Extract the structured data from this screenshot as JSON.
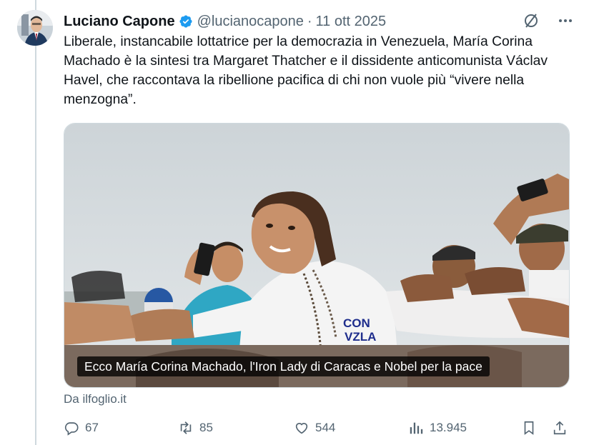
{
  "tweet": {
    "author_name": "Luciano Capone",
    "handle": "@lucianocapone",
    "separator": "·",
    "date": "11 ott 2025",
    "text": "Liberale, instancabile lottatrice per la democrazia in Venezuela, María Corina Machado è la sintesi tra Margaret Thatcher e il dissidente anticomunista Václav Havel, che raccontava la ribellione pacifica di chi non vuole più “vivere nella menzogna”.",
    "verified_color": "#1d9bf0"
  },
  "media": {
    "caption": "Ecco María Corina Machado, l'Iron Lady di Caracas e Nobel per la pace",
    "shirt_text_line1": "CON",
    "shirt_text_line2": "VZLA"
  },
  "source": "Da ilfoglio.it",
  "actions": {
    "replies": "67",
    "reposts": "85",
    "likes": "544",
    "views": "13.945"
  },
  "icons": [
    "grok-icon",
    "more-icon",
    "reply-icon",
    "repost-icon",
    "like-icon",
    "views-icon",
    "bookmark-icon",
    "share-icon"
  ]
}
